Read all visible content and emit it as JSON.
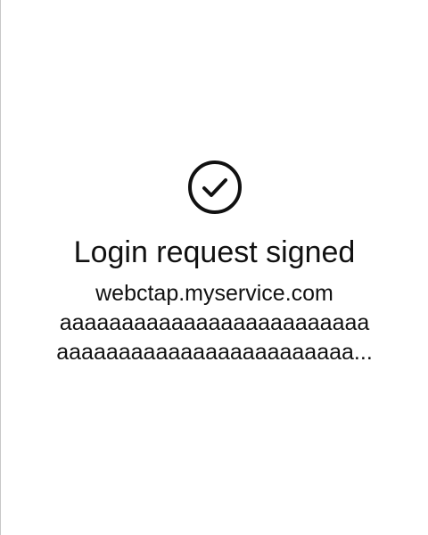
{
  "status": {
    "icon": "check-circle-icon",
    "title": "Login request signed",
    "lines": [
      "webctap.myservice.com",
      "aaaaaaaaaaaaaaaaaaaaaaaaa",
      "aaaaaaaaaaaaaaaaaaaaaaaa..."
    ]
  }
}
